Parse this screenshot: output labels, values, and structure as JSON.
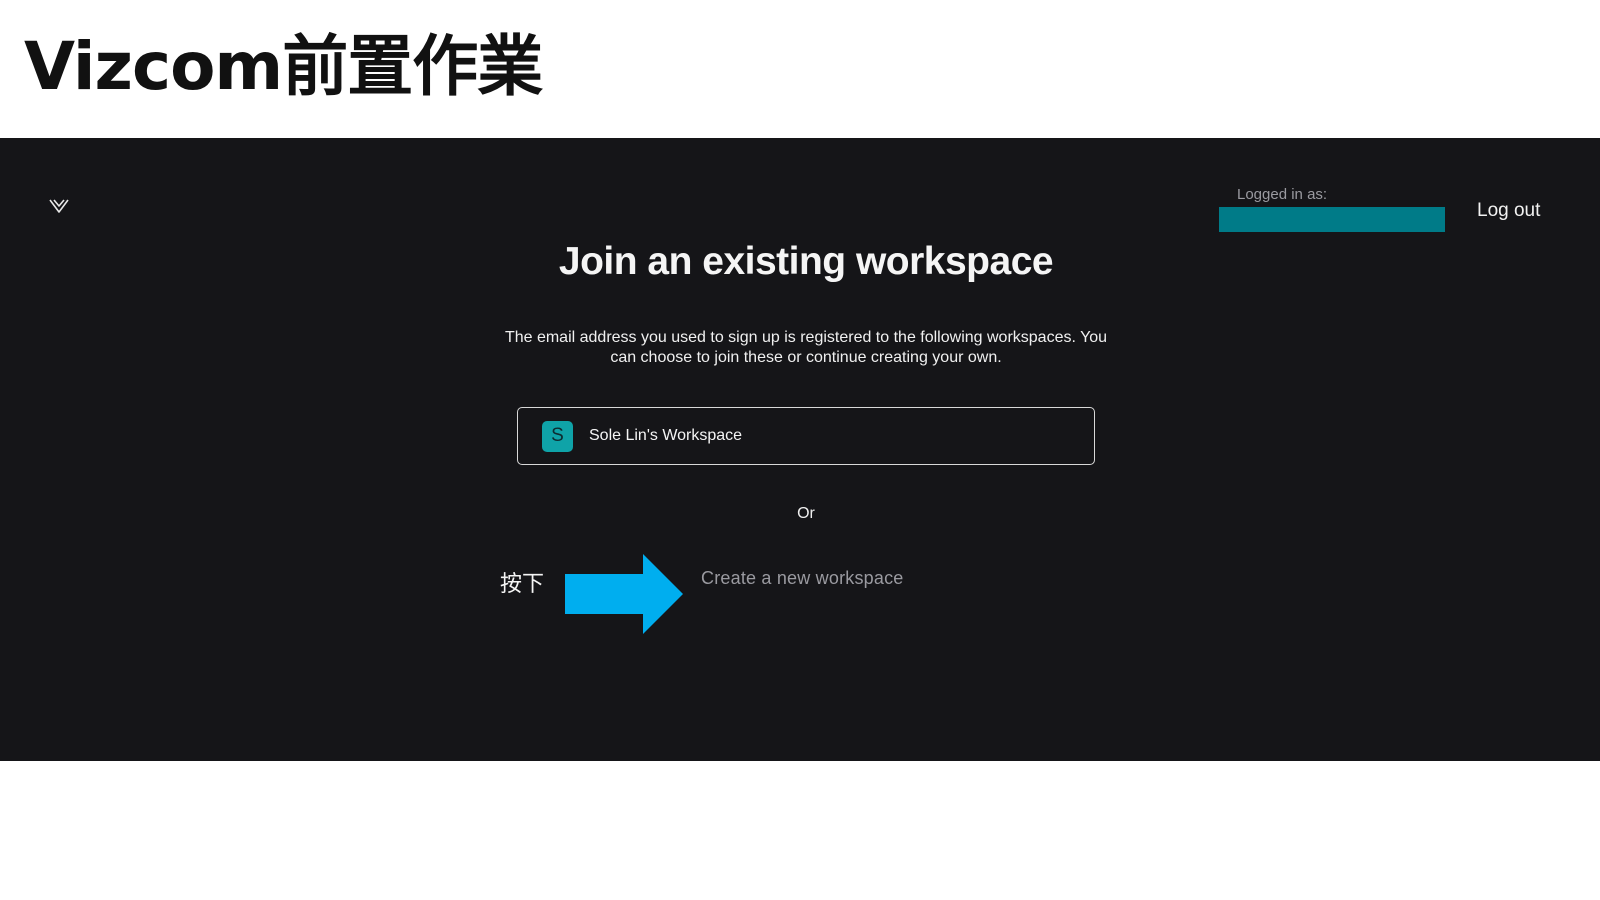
{
  "slide": {
    "title": "Vizcom前置作業"
  },
  "header": {
    "logged_in_label": "Logged in as:",
    "logout_label": "Log out"
  },
  "main": {
    "heading": "Join an existing workspace",
    "description": "The email address you used to sign up is registered to the following workspaces. You can choose to join these or continue creating your own.",
    "workspaces": [
      {
        "initial": "S",
        "name": "Sole Lin's Workspace"
      }
    ],
    "or_label": "Or",
    "create_label": "Create a new workspace"
  },
  "annotation": {
    "label": "按下"
  },
  "colors": {
    "app_background": "#151518",
    "redaction": "#007b88",
    "avatar": "#0fa3a8",
    "arrow": "#00aeef"
  },
  "icons": {
    "logo": "chevron-down-logo-icon",
    "pointer": "right-arrow-icon"
  }
}
